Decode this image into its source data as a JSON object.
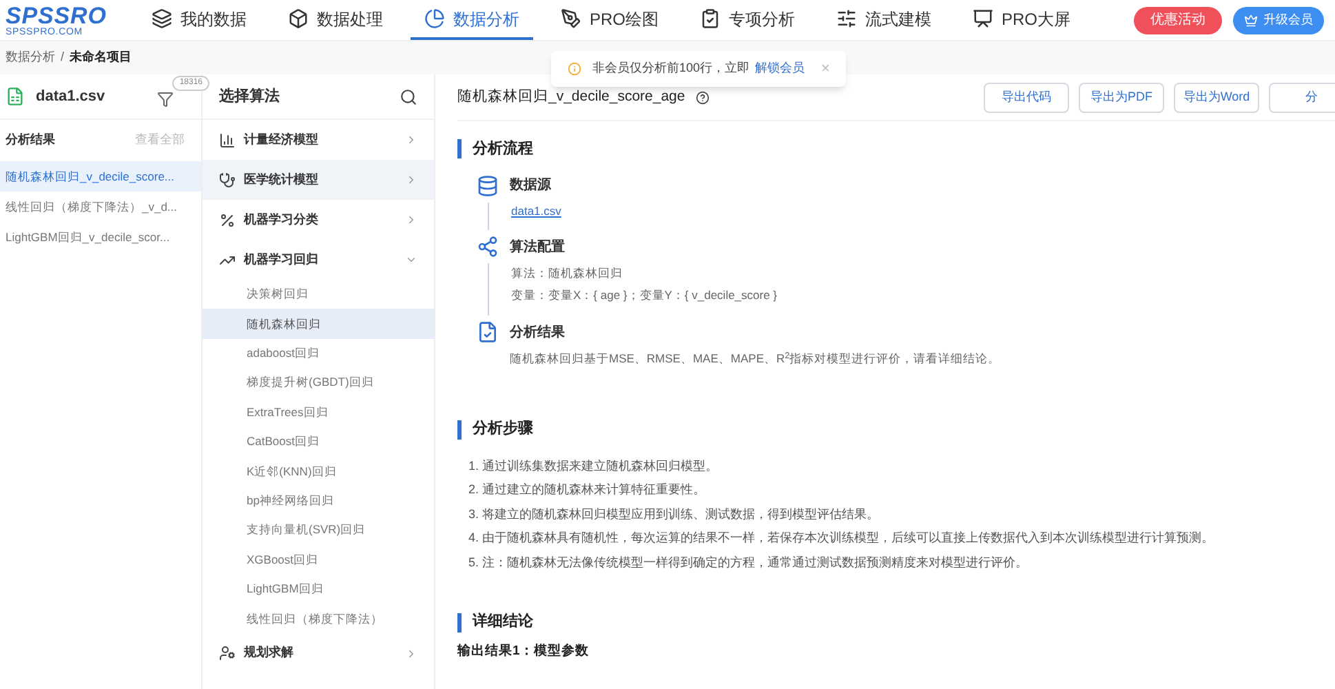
{
  "logo": {
    "name": "SPSSRO",
    "sub": "SPSSPRO.COM"
  },
  "nav": [
    {
      "label": "我的数据",
      "selected": false
    },
    {
      "label": "数据处理",
      "selected": false
    },
    {
      "label": "数据分析",
      "selected": true
    },
    {
      "label": "PRO绘图",
      "selected": false
    },
    {
      "label": "专项分析",
      "selected": false
    },
    {
      "label": "流式建模",
      "selected": false
    },
    {
      "label": "PRO大屏",
      "selected": false
    }
  ],
  "promo_button": "优惠活动",
  "upgrade_button": "升级会员",
  "breadcrumb": [
    "数据分析",
    "/",
    "未命名项目"
  ],
  "toast": {
    "text": "非会员仅分析前100行，立即",
    "link": "解锁会员",
    "close": "×"
  },
  "file_panel": {
    "file": "data1.csv",
    "badge": "18316",
    "section": "分析结果",
    "view_all": "查看全部",
    "results": [
      {
        "label": "随机森林回归_v_decile_score...",
        "selected": true
      },
      {
        "label": "线性回归（梯度下降法）_v_d...",
        "selected": false
      },
      {
        "label": "LightGBM回归_v_decile_scor...",
        "selected": false
      }
    ]
  },
  "algo_panel": {
    "title": "选择算法",
    "categories": [
      {
        "label": "计量经济模型",
        "selected": false,
        "expanded": false
      },
      {
        "label": "医学统计模型",
        "selected": true,
        "expanded": false
      },
      {
        "label": "机器学习分类",
        "selected": false,
        "expanded": false
      },
      {
        "label": "机器学习回归",
        "selected": false,
        "expanded": true,
        "children": [
          {
            "label": "决策树回归",
            "selected": false
          },
          {
            "label": "随机森林回归",
            "selected": true
          },
          {
            "label": "adaboost回归",
            "selected": false
          },
          {
            "label": "梯度提升树(GBDT)回归",
            "selected": false
          },
          {
            "label": "ExtraTrees回归",
            "selected": false
          },
          {
            "label": "CatBoost回归",
            "selected": false
          },
          {
            "label": "K近邻(KNN)回归",
            "selected": false
          },
          {
            "label": "bp神经网络回归",
            "selected": false
          },
          {
            "label": "支持向量机(SVR)回归",
            "selected": false
          },
          {
            "label": "XGBoost回归",
            "selected": false
          },
          {
            "label": "LightGBM回归",
            "selected": false
          },
          {
            "label": "线性回归（梯度下降法）",
            "selected": false
          }
        ]
      },
      {
        "label": "规划求解",
        "selected": false,
        "expanded": false
      }
    ]
  },
  "report": {
    "title": "随机森林回归_v_decile_score_age",
    "buttons": [
      "导出代码",
      "导出为PDF",
      "导出为Word",
      "分"
    ],
    "flow_title": "分析流程",
    "flow": [
      {
        "kind": "datasource",
        "title": "数据源",
        "link": "data1.csv"
      },
      {
        "kind": "config",
        "title": "算法配置",
        "lines": [
          "算法：随机森林回归",
          "变量：变量X：{ age }；变量Y：{ v_decile_score }"
        ]
      },
      {
        "kind": "result",
        "title": "分析结果",
        "lines": [
          "随机森林回归基于MSE、RMSE、MAE、MAPE、R$^{2}$指标对模型进行评价，请看详细结论。"
        ]
      }
    ],
    "steps_title": "分析步骤",
    "steps": [
      "1. 通过训练集数据来建立随机森林回归模型。",
      "2. 通过建立的随机森林来计算特征重要性。",
      "3. 将建立的随机森林回归模型应用到训练、测试数据，得到模型评估结果。",
      "4. 由于随机森林具有随机性，每次运算的结果不一样，若保存本次训练模型，后续可以直接上传数据代入到本次训练模型进行计算预测。",
      "5. 注：随机森林无法像传统模型一样得到确定的方程，通常通过测试数据预测精度来对模型进行评价。"
    ],
    "conclusion_title": "详细结论",
    "output_title": "输出结果1：模型参数"
  }
}
